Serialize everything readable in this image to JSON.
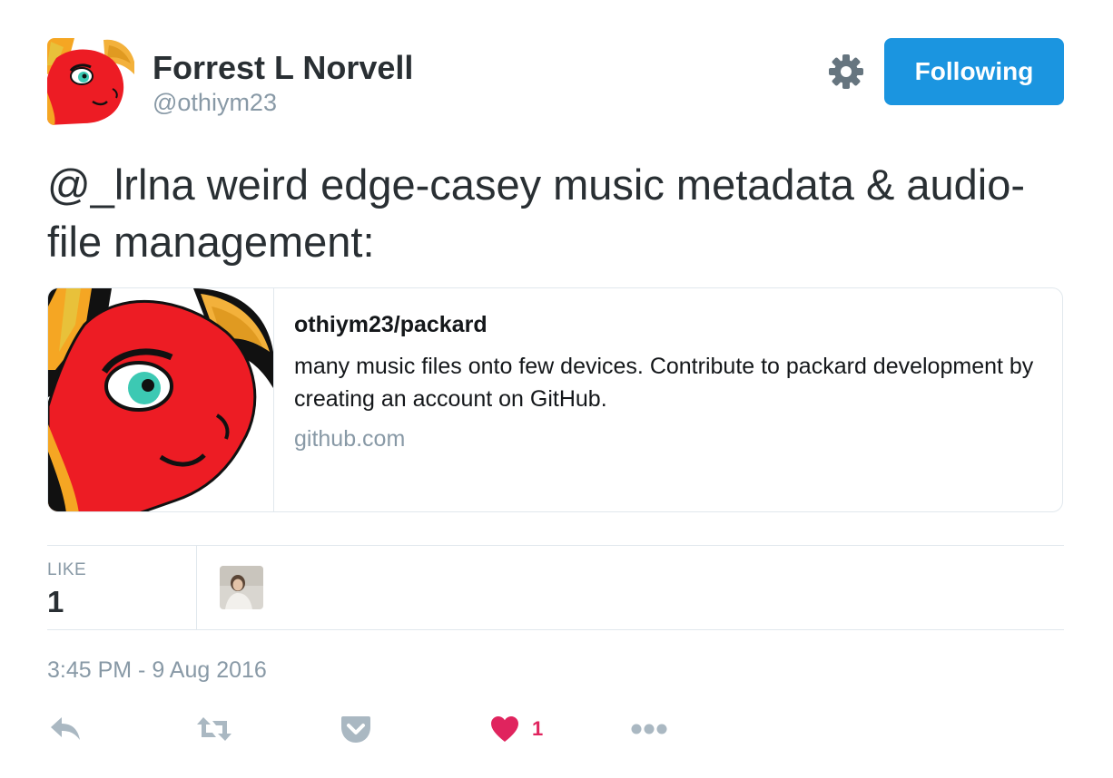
{
  "user": {
    "display_name": "Forrest L Norvell",
    "screen_name": "@othiym23",
    "avatar_icon": "red-pony-avatar"
  },
  "header": {
    "settings_icon": "gear-icon",
    "follow_button_label": "Following"
  },
  "tweet": {
    "mention": "@_lrlna",
    "text": " weird edge-casey music metadata & audio-file management:"
  },
  "card": {
    "title": "othiym23/packard",
    "description": "many music files onto few devices. Contribute to packard development by creating an account on GitHub.",
    "domain": "github.com",
    "image_icon": "red-pony-avatar"
  },
  "stats": {
    "like_label": "LIKE",
    "like_count": "1"
  },
  "timestamp": "3:45 PM - 9 Aug 2016",
  "actions": {
    "reply_icon": "reply-icon",
    "retweet_icon": "retweet-icon",
    "pocket_icon": "pocket-icon",
    "like_icon": "heart-icon",
    "like_count": "1",
    "more_icon": "more-dots-icon"
  },
  "colors": {
    "accent": "#1b95e0",
    "like": "#e0245e",
    "muted": "#8899a6",
    "text": "#292f33",
    "border": "#e1e8ed"
  }
}
